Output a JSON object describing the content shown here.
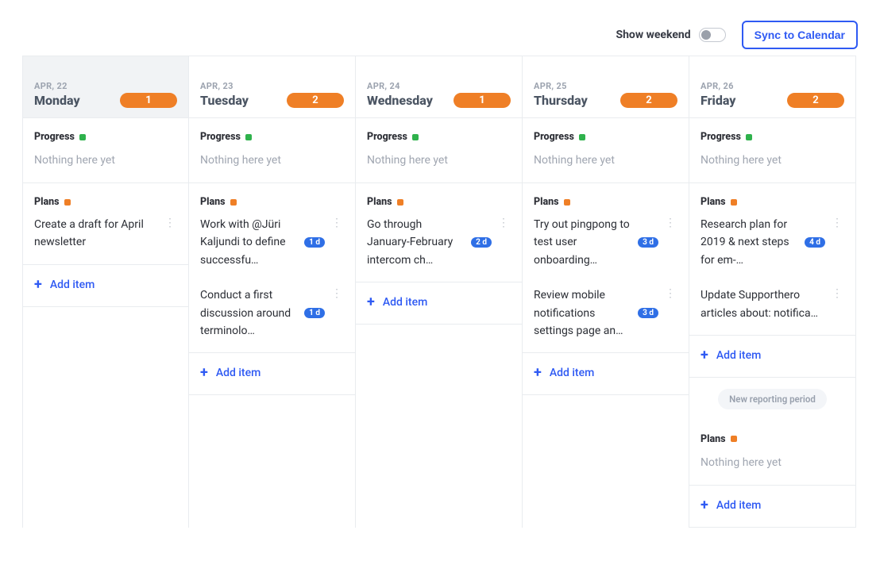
{
  "topbar": {
    "show_weekend_label": "Show weekend",
    "sync_label": "Sync to Calendar"
  },
  "labels": {
    "progress": "Progress",
    "plans": "Plans",
    "nothing": "Nothing here yet",
    "add_item": "Add item",
    "new_reporting_period": "New reporting period"
  },
  "days": [
    {
      "date_label": "APR, 22",
      "name": "Monday",
      "count": "1",
      "active": true,
      "plans": [
        {
          "text": "Create a draft for April newsletter"
        }
      ]
    },
    {
      "date_label": "APR, 23",
      "name": "Tuesday",
      "count": "2",
      "plans": [
        {
          "text": "Work with @Jüri Kaljun­di to define successfu…",
          "pill": "1 d"
        },
        {
          "text": "Conduct a first discus­sion around terminolo…",
          "pill": "1 d"
        }
      ]
    },
    {
      "date_label": "APR, 24",
      "name": "Wednesday",
      "count": "1",
      "plans": [
        {
          "text": "Go through January-February intercom ch…",
          "pill": "2 d"
        }
      ]
    },
    {
      "date_label": "APR, 25",
      "name": "Thursday",
      "count": "2",
      "plans": [
        {
          "text": "Try out pingpong to test user onboarding…",
          "pill": "3 d"
        },
        {
          "text": "Review mobile notifica­tions settings page an…",
          "pill": "3 d"
        }
      ]
    },
    {
      "date_label": "APR, 26",
      "name": "Friday",
      "count": "2",
      "plans": [
        {
          "text": "Research plan for 2019 & next steps for em-…",
          "pill": "4 d"
        },
        {
          "text": "Update Supporthero articles about: notifica…"
        }
      ],
      "extra": true
    }
  ]
}
